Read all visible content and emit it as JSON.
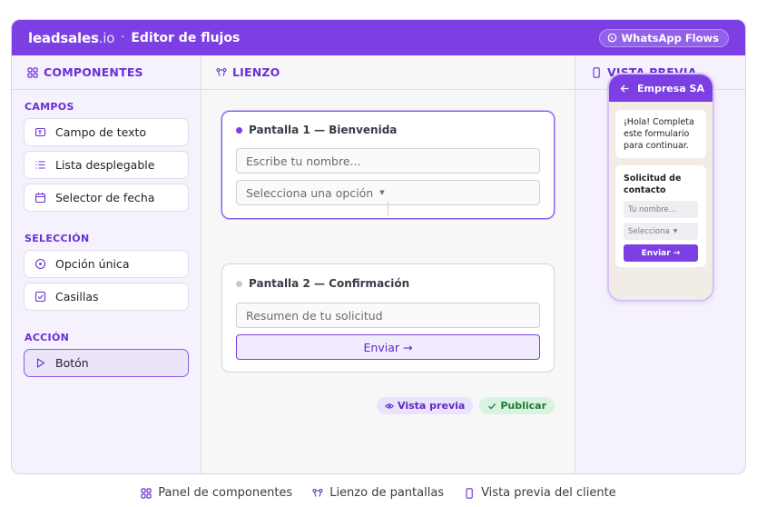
{
  "topbar": {
    "brand": "leadsales",
    "brand_tld": ".io",
    "separator": "·",
    "title": "Editor de flujos",
    "badge": "WhatsApp Flows"
  },
  "panels": {
    "components": "COMPONENTES",
    "canvas": "LIENZO",
    "preview": "VISTA PREVIA"
  },
  "components": {
    "groups": [
      {
        "label": "CAMPOS",
        "items": [
          {
            "label": "Campo de texto",
            "icon": "text-field-icon"
          },
          {
            "label": "Lista desplegable",
            "icon": "list-icon"
          },
          {
            "label": "Selector de fecha",
            "icon": "calendar-icon"
          }
        ]
      },
      {
        "label": "SELECCIÓN",
        "items": [
          {
            "label": "Opción única",
            "icon": "radio-icon"
          },
          {
            "label": "Casillas",
            "icon": "checkbox-icon"
          }
        ]
      },
      {
        "label": "ACCIÓN",
        "items": [
          {
            "label": "Botón",
            "icon": "play-icon",
            "active": true
          }
        ]
      }
    ]
  },
  "canvas": {
    "screens": [
      {
        "title": "Pantalla 1 — Bienvenida",
        "fields": [
          "Escribe tu nombre...",
          "Selecciona una opción"
        ],
        "selected": true
      },
      {
        "title": "Pantalla 2 — Confirmación",
        "fields": [
          "Resumen de tu solicitud"
        ],
        "button": "Enviar →"
      }
    ],
    "caret": "▼",
    "actions": {
      "preview": "Vista previa",
      "publish": "Publicar"
    }
  },
  "phone": {
    "header": "Empresa SA",
    "message": "¡Hola! Completa este formulario para continuar.",
    "form_title": "Solicitud de contacto",
    "name_placeholder": "Tu nombre...",
    "select_placeholder": "Selecciona",
    "submit": "Enviar →"
  },
  "legend": {
    "components": "Panel de componentes",
    "canvas": "Lienzo de pantallas",
    "preview": "Vista previa del cliente"
  },
  "colors": {
    "accent": "#7b3fe4",
    "accent_light": "#f5f1fd",
    "publish_bg": "#d8f3de",
    "publish_text": "#1f7a3a"
  }
}
